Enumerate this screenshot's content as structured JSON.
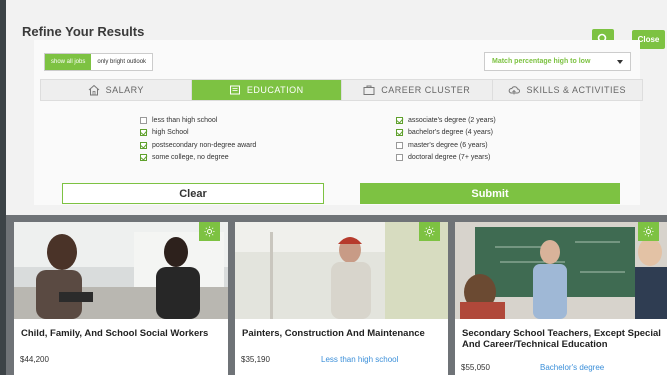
{
  "panel": {
    "title": "Refine Your Results",
    "close_label": "Close"
  },
  "toggle": {
    "show_all": "show all jobs",
    "bright_outlook": "only bright outlook"
  },
  "sort": {
    "selected": "Match percentage high to low"
  },
  "tabs": [
    {
      "label": "Salary",
      "icon": "house-icon"
    },
    {
      "label": "Education",
      "icon": "book-icon"
    },
    {
      "label": "Career Cluster",
      "icon": "briefcase-icon"
    },
    {
      "label": "Skills & Activities",
      "icon": "cloud-icon"
    }
  ],
  "education_left": [
    {
      "label": "less than high school",
      "checked": false
    },
    {
      "label": "high School",
      "checked": true
    },
    {
      "label": "postsecondary non-degree award",
      "checked": true
    },
    {
      "label": "some college, no degree",
      "checked": true
    }
  ],
  "education_right": [
    {
      "label": "associate's degree (2 years)",
      "checked": true
    },
    {
      "label": "bachelor's degree (4 years)",
      "checked": true
    },
    {
      "label": "master's degree (6 years)",
      "checked": false
    },
    {
      "label": "doctoral degree (7+ years)",
      "checked": false
    }
  ],
  "actions": {
    "clear": "Clear",
    "submit": "Submit"
  },
  "cards": [
    {
      "title": "Child, Family, And School Social Workers",
      "wage": "$44,200",
      "education": ""
    },
    {
      "title": "Painters, Construction And Maintenance",
      "wage": "$35,190",
      "education": "Less than high school"
    },
    {
      "title": "Secondary School Teachers, Except Special And Career/Technical Education",
      "wage": "$55,050",
      "education": "Bachelor's degree"
    }
  ],
  "colors": {
    "accent": "#7dc242",
    "link": "#3b8fd9"
  }
}
